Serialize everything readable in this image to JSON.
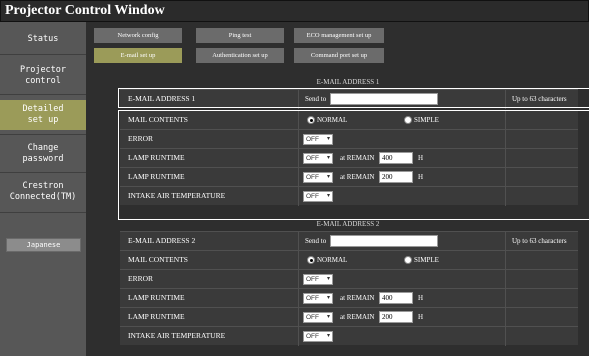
{
  "window": {
    "title": "Projector Control Window"
  },
  "sidebar": {
    "items": [
      {
        "label": "Status"
      },
      {
        "label": "Projector\ncontrol"
      },
      {
        "label": "Detailed\nset up"
      },
      {
        "label": "Change\npassword"
      },
      {
        "label": "Crestron\nConnected(TM)"
      }
    ],
    "language_button": "Japanese"
  },
  "tabs": {
    "row1": [
      "Network config",
      "Ping test",
      "ECO management set up"
    ],
    "row2": [
      "E-mail set up",
      "Authentication set up",
      "Command port set up"
    ]
  },
  "section1": {
    "heading": "E-MAIL ADDRESS 1",
    "address_label": "E-MAIL ADDRESS 1",
    "send_to": "Send to",
    "address_value": "",
    "limit_note": "Up to 63 characters",
    "mail_contents_label": "MAIL CONTENTS",
    "normal_label": "NORMAL",
    "simple_label": "SIMPLE",
    "error_label": "ERROR",
    "error_value": "OFF",
    "lamp1_label": "LAMP RUNTIME",
    "lamp1_value": "OFF",
    "lamp1_remain_label": "at REMAIN",
    "lamp1_remain_value": "400",
    "lamp1_unit": "H",
    "lamp2_label": "LAMP RUNTIME",
    "lamp2_value": "OFF",
    "lamp2_remain_label": "at REMAIN",
    "lamp2_remain_value": "200",
    "lamp2_unit": "H",
    "intake_label": "INTAKE AIR TEMPERATURE",
    "intake_value": "OFF"
  },
  "section2": {
    "heading": "E-MAIL ADDRESS 2",
    "address_label": "E-MAIL ADDRESS 2",
    "send_to": "Send to",
    "address_value": "",
    "limit_note": "Up to 63 characters",
    "mail_contents_label": "MAIL CONTENTS",
    "normal_label": "NORMAL",
    "simple_label": "SIMPLE",
    "error_label": "ERROR",
    "error_value": "OFF",
    "lamp1_label": "LAMP RUNTIME",
    "lamp1_value": "OFF",
    "lamp1_remain_label": "at REMAIN",
    "lamp1_remain_value": "400",
    "lamp1_unit": "H",
    "lamp2_label": "LAMP RUNTIME",
    "lamp2_value": "OFF",
    "lamp2_remain_label": "at REMAIN",
    "lamp2_remain_value": "200",
    "lamp2_unit": "H",
    "intake_label": "INTAKE AIR TEMPERATURE",
    "intake_value": "OFF"
  },
  "icons": {
    "select_chevron": "chevron-down-icon"
  }
}
